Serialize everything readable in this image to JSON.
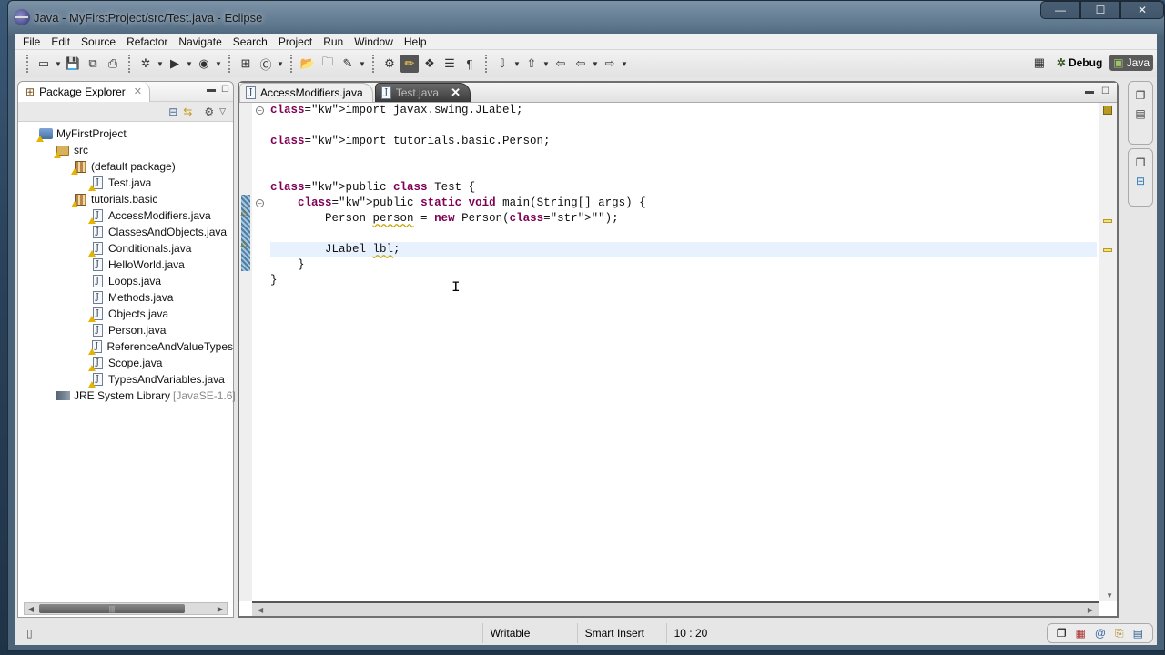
{
  "window": {
    "title": "Java - MyFirstProject/src/Test.java - Eclipse",
    "controls": {
      "minimize": "—",
      "maximize": "☐",
      "close": "✕"
    }
  },
  "menubar": {
    "items": [
      "File",
      "Edit",
      "Source",
      "Refactor",
      "Navigate",
      "Search",
      "Project",
      "Run",
      "Window",
      "Help"
    ]
  },
  "toolbar": {
    "groups": [
      [
        {
          "name": "new",
          "icon": "new-wizard-icon",
          "glyph": "▭",
          "dropdown": true
        },
        {
          "name": "save",
          "icon": "save-icon",
          "glyph": "💾"
        },
        {
          "name": "save-all",
          "icon": "save-all-icon",
          "glyph": "⧉"
        },
        {
          "name": "print",
          "icon": "print-icon",
          "glyph": "⎙"
        }
      ],
      [
        {
          "name": "debug",
          "icon": "debug-bug-icon",
          "glyph": "✲",
          "dropdown": true
        },
        {
          "name": "run",
          "icon": "run-icon",
          "glyph": "▶",
          "dropdown": true
        },
        {
          "name": "external-tools",
          "icon": "external-tools-icon",
          "glyph": "◉",
          "dropdown": true
        }
      ],
      [
        {
          "name": "new-java-package",
          "icon": "new-package-icon",
          "glyph": "⊞"
        },
        {
          "name": "new-java-class",
          "icon": "new-class-icon",
          "glyph": "Ⓒ",
          "dropdown": true
        }
      ],
      [
        {
          "name": "open-type",
          "icon": "open-type-icon",
          "glyph": "📂"
        },
        {
          "name": "open-task",
          "icon": "open-folder-icon",
          "glyph": "🗀"
        },
        {
          "name": "search",
          "icon": "search-torch-icon",
          "glyph": "✎",
          "dropdown": true
        }
      ],
      [
        {
          "name": "toggle-ant-editor",
          "icon": "toggle-breadcrumb-icon",
          "glyph": "⚙"
        },
        {
          "name": "mark-occurrences",
          "icon": "mark-occurrences-icon",
          "glyph": "✏",
          "pressed": true
        },
        {
          "name": "toggle-block-selection",
          "icon": "block-selection-icon",
          "glyph": "❖"
        },
        {
          "name": "show-source-of-selected",
          "icon": "show-source-icon",
          "glyph": "☰"
        },
        {
          "name": "show-whitespace",
          "icon": "pilcrow-icon",
          "glyph": "¶"
        }
      ],
      [
        {
          "name": "next-annotation",
          "icon": "next-annotation-icon",
          "glyph": "⇩",
          "dropdown": true
        },
        {
          "name": "previous-annotation",
          "icon": "previous-annotation-icon",
          "glyph": "⇧",
          "dropdown": true
        },
        {
          "name": "last-edit-location",
          "icon": "last-edit-icon",
          "glyph": "⇦"
        },
        {
          "name": "back",
          "icon": "back-arrow-icon",
          "glyph": "⇦",
          "dropdown": true
        },
        {
          "name": "forward",
          "icon": "forward-arrow-icon",
          "glyph": "⇨",
          "dropdown": true
        }
      ]
    ],
    "perspectives": {
      "open_perspective_icon": "open-perspective-icon",
      "debug_label": "Debug",
      "java_label": "Java"
    }
  },
  "package_explorer": {
    "tab_label": "Package Explorer",
    "tree": [
      {
        "label": "MyFirstProject",
        "type": "project",
        "depth": 0,
        "warning": true
      },
      {
        "label": "src",
        "type": "source-folder",
        "depth": 1,
        "warning": true
      },
      {
        "label": "(default package)",
        "type": "package",
        "depth": 2,
        "warning": true
      },
      {
        "label": "Test.java",
        "type": "file",
        "depth": 3,
        "warning": true
      },
      {
        "label": "tutorials.basic",
        "type": "package",
        "depth": 2,
        "warning": true
      },
      {
        "label": "AccessModifiers.java",
        "type": "file",
        "depth": 3,
        "warning": true
      },
      {
        "label": "ClassesAndObjects.java",
        "type": "file",
        "depth": 3,
        "warning": false
      },
      {
        "label": "Conditionals.java",
        "type": "file",
        "depth": 3,
        "warning": true
      },
      {
        "label": "HelloWorld.java",
        "type": "file",
        "depth": 3,
        "warning": false
      },
      {
        "label": "Loops.java",
        "type": "file",
        "depth": 3,
        "warning": false
      },
      {
        "label": "Methods.java",
        "type": "file",
        "depth": 3,
        "warning": false
      },
      {
        "label": "Objects.java",
        "type": "file",
        "depth": 3,
        "warning": true
      },
      {
        "label": "Person.java",
        "type": "file",
        "depth": 3,
        "warning": false
      },
      {
        "label": "ReferenceAndValueTypes",
        "type": "file",
        "depth": 3,
        "warning": true
      },
      {
        "label": "Scope.java",
        "type": "file",
        "depth": 3,
        "warning": true
      },
      {
        "label": "TypesAndVariables.java",
        "type": "file",
        "depth": 3,
        "warning": true
      },
      {
        "label": "JRE System Library",
        "suffix": "[JavaSE-1.6]",
        "type": "library",
        "depth": 1,
        "warning": false
      }
    ]
  },
  "editor": {
    "tabs": [
      {
        "label": "AccessModifiers.java",
        "active": false,
        "warning": true
      },
      {
        "label": "Test.java",
        "active": true,
        "warning": true
      }
    ],
    "lines": [
      {
        "text": "import javax.swing.JLabel;",
        "fold": true
      },
      {
        "text": ""
      },
      {
        "text": "import tutorials.basic.Person;"
      },
      {
        "text": ""
      },
      {
        "text": ""
      },
      {
        "text": "public class Test {"
      },
      {
        "text": "    public static void main(String[] args) {",
        "fold": true
      },
      {
        "text": "        Person person = new Person(\"\");",
        "warning": true
      },
      {
        "text": ""
      },
      {
        "text": "        JLabel lbl;",
        "warning": true,
        "current": true
      },
      {
        "text": "    }"
      },
      {
        "text": "}"
      }
    ]
  },
  "statusbar": {
    "writable": "Writable",
    "insert_mode": "Smart Insert",
    "position": "10 : 20"
  }
}
